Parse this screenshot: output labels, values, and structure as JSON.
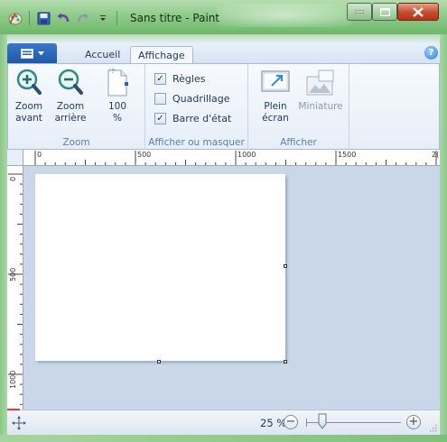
{
  "window": {
    "title": "Sans titre - Paint",
    "accent": "#8fcb8a"
  },
  "ribbon": {
    "tabs": [
      {
        "label": "Accueil"
      },
      {
        "label": "Affichage"
      }
    ],
    "groups": {
      "zoom": {
        "label": "Zoom",
        "zoom_in": "Zoom\navant",
        "zoom_out": "Zoom\narrière",
        "zoom_100": "100\n%"
      },
      "show": {
        "label": "Afficher ou masquer",
        "rulers": {
          "label": "Règles",
          "checked": true
        },
        "gridlines": {
          "label": "Quadrillage",
          "checked": false
        },
        "statusbar": {
          "label": "Barre d'état",
          "checked": true
        }
      },
      "display": {
        "label": "Afficher",
        "fullscreen": "Plein\nécran",
        "thumbnail": "Miniature"
      }
    }
  },
  "rulers": {
    "horizontal": [
      "0",
      "500",
      "1000",
      "1500",
      "2("
    ],
    "vertical": [
      "0",
      "500",
      "1000"
    ]
  },
  "statusbar": {
    "zoom": "25 %",
    "zoom_minus": "−",
    "zoom_plus": "+"
  }
}
